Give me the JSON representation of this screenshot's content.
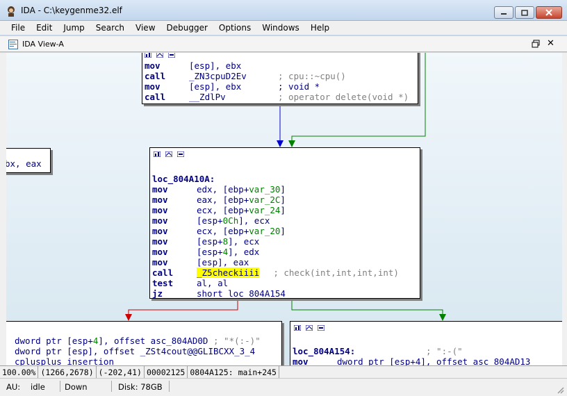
{
  "window": {
    "title": "IDA - C:\\keygenme32.elf"
  },
  "menu": [
    "File",
    "Edit",
    "Jump",
    "Search",
    "View",
    "Debugger",
    "Options",
    "Windows",
    "Help"
  ],
  "view": {
    "title": "IDA View-A",
    "close": "✕"
  },
  "nodes": {
    "top": {
      "lines": [
        {
          "m": "mov",
          "o": "[esp], ebx",
          "c": ""
        },
        {
          "m": "call",
          "o": "_ZN3cpuD2Ev",
          "c": "; cpu::~cpu()"
        },
        {
          "m": "mov",
          "o": "[esp], ebx",
          "c": "; void *"
        },
        {
          "m": "call",
          "o": "__ZdlPv",
          "c": "; operator delete(void *)"
        }
      ]
    },
    "left_partial": {
      "text": "bx, eax"
    },
    "main": {
      "label": "loc_804A10A:",
      "lines": [
        {
          "m": "mov",
          "pre": "edx, [ebp+",
          "g": "var_30",
          "post": "]"
        },
        {
          "m": "mov",
          "pre": "eax, [ebp+",
          "g": "var_2C",
          "post": "]"
        },
        {
          "m": "mov",
          "pre": "ecx, [ebp+",
          "g": "var_24",
          "post": "]"
        },
        {
          "m": "mov",
          "pre": "[esp+",
          "g": "0Ch",
          "post": "], ecx"
        },
        {
          "m": "mov",
          "pre": "ecx, [ebp+",
          "g": "var_20",
          "post": "]"
        },
        {
          "m": "mov",
          "pre": "[esp+",
          "g": "8",
          "post": "], ecx"
        },
        {
          "m": "mov",
          "pre": "[esp+",
          "g": "4",
          "post": "], edx"
        },
        {
          "m": "mov",
          "pre": "[esp], eax",
          "g": "",
          "post": ""
        }
      ],
      "call": {
        "m": "call",
        "fn": "_Z5checkiiii",
        "c": "; check(int,int,int,int)"
      },
      "test": {
        "m": "test",
        "o": "al, al"
      },
      "jz": {
        "m": "jz",
        "o": "short loc_804A154"
      }
    },
    "bottom_left": {
      "l1": {
        "pre": "dword ptr [esp+",
        "g": "4",
        "post": "], offset asc_804AD0D",
        "c": " ; \"*(:-)\""
      },
      "l2": {
        "t": "dword ptr [esp], offset _ZSt4cout@@GLIBCXX_3_4"
      },
      "l3": {
        "t": "cplusplus insertion"
      }
    },
    "bottom_right": {
      "label": "loc_804A154:",
      "c": "; \":-(\"",
      "l2": {
        "m": "mov",
        "o": "dword ptr [esp+4], offset asc_804AD13"
      }
    }
  },
  "statusbar": {
    "zoom": "100.00%",
    "coords": "(1266,2678)",
    "offset": "(-202,41)",
    "addr": "00002125",
    "loc": "0804A125: main+245"
  },
  "bottombar": {
    "au_label": "AU:",
    "au_state": "idle",
    "direction": "Down",
    "disk": "Disk: 78GB"
  },
  "colors": {
    "edge_true": "#008000",
    "edge_false": "#cc0000",
    "edge_uncond": "#0000cc"
  }
}
